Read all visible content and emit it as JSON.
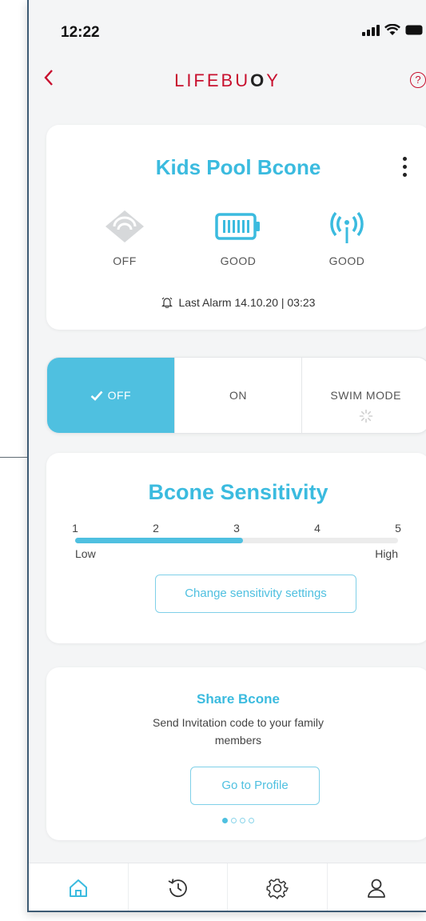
{
  "status_bar": {
    "time": "12:22"
  },
  "header": {
    "back_icon": "chevron-left-icon",
    "logo_prefix": "LIFEBU",
    "logo_o": "O",
    "logo_suffix": "Y",
    "help_label": "?"
  },
  "device": {
    "title": "Kids Pool Bcone",
    "stats": [
      {
        "icon": "water-sensor-icon",
        "label": "OFF"
      },
      {
        "icon": "battery-icon",
        "label": "GOOD"
      },
      {
        "icon": "signal-antenna-icon",
        "label": "GOOD"
      }
    ],
    "last_alarm_label": "Last Alarm",
    "last_alarm_value": "14.10.20 | 03:23"
  },
  "modes": [
    {
      "label": "OFF",
      "selected": true
    },
    {
      "label": "ON",
      "selected": false
    },
    {
      "label": "SWIM MODE",
      "selected": false,
      "loading": true
    }
  ],
  "sensitivity": {
    "title": "Bcone Sensitivity",
    "ticks": [
      "1",
      "2",
      "3",
      "4",
      "5"
    ],
    "level": 3,
    "max": 5,
    "low_label": "Low",
    "high_label": "High",
    "button_label": "Change sensitivity settings"
  },
  "share": {
    "title": "Share Bcone",
    "description": "Send Invitation code to your family members",
    "button_label": "Go to Profile",
    "page_index": 0,
    "page_count": 4
  },
  "tabbar": [
    "home-icon",
    "history-icon",
    "settings-icon",
    "profile-icon"
  ],
  "colors": {
    "brand_red": "#c8102e",
    "accent_blue": "#4fc0e0",
    "title_blue": "#3bbbdf"
  }
}
